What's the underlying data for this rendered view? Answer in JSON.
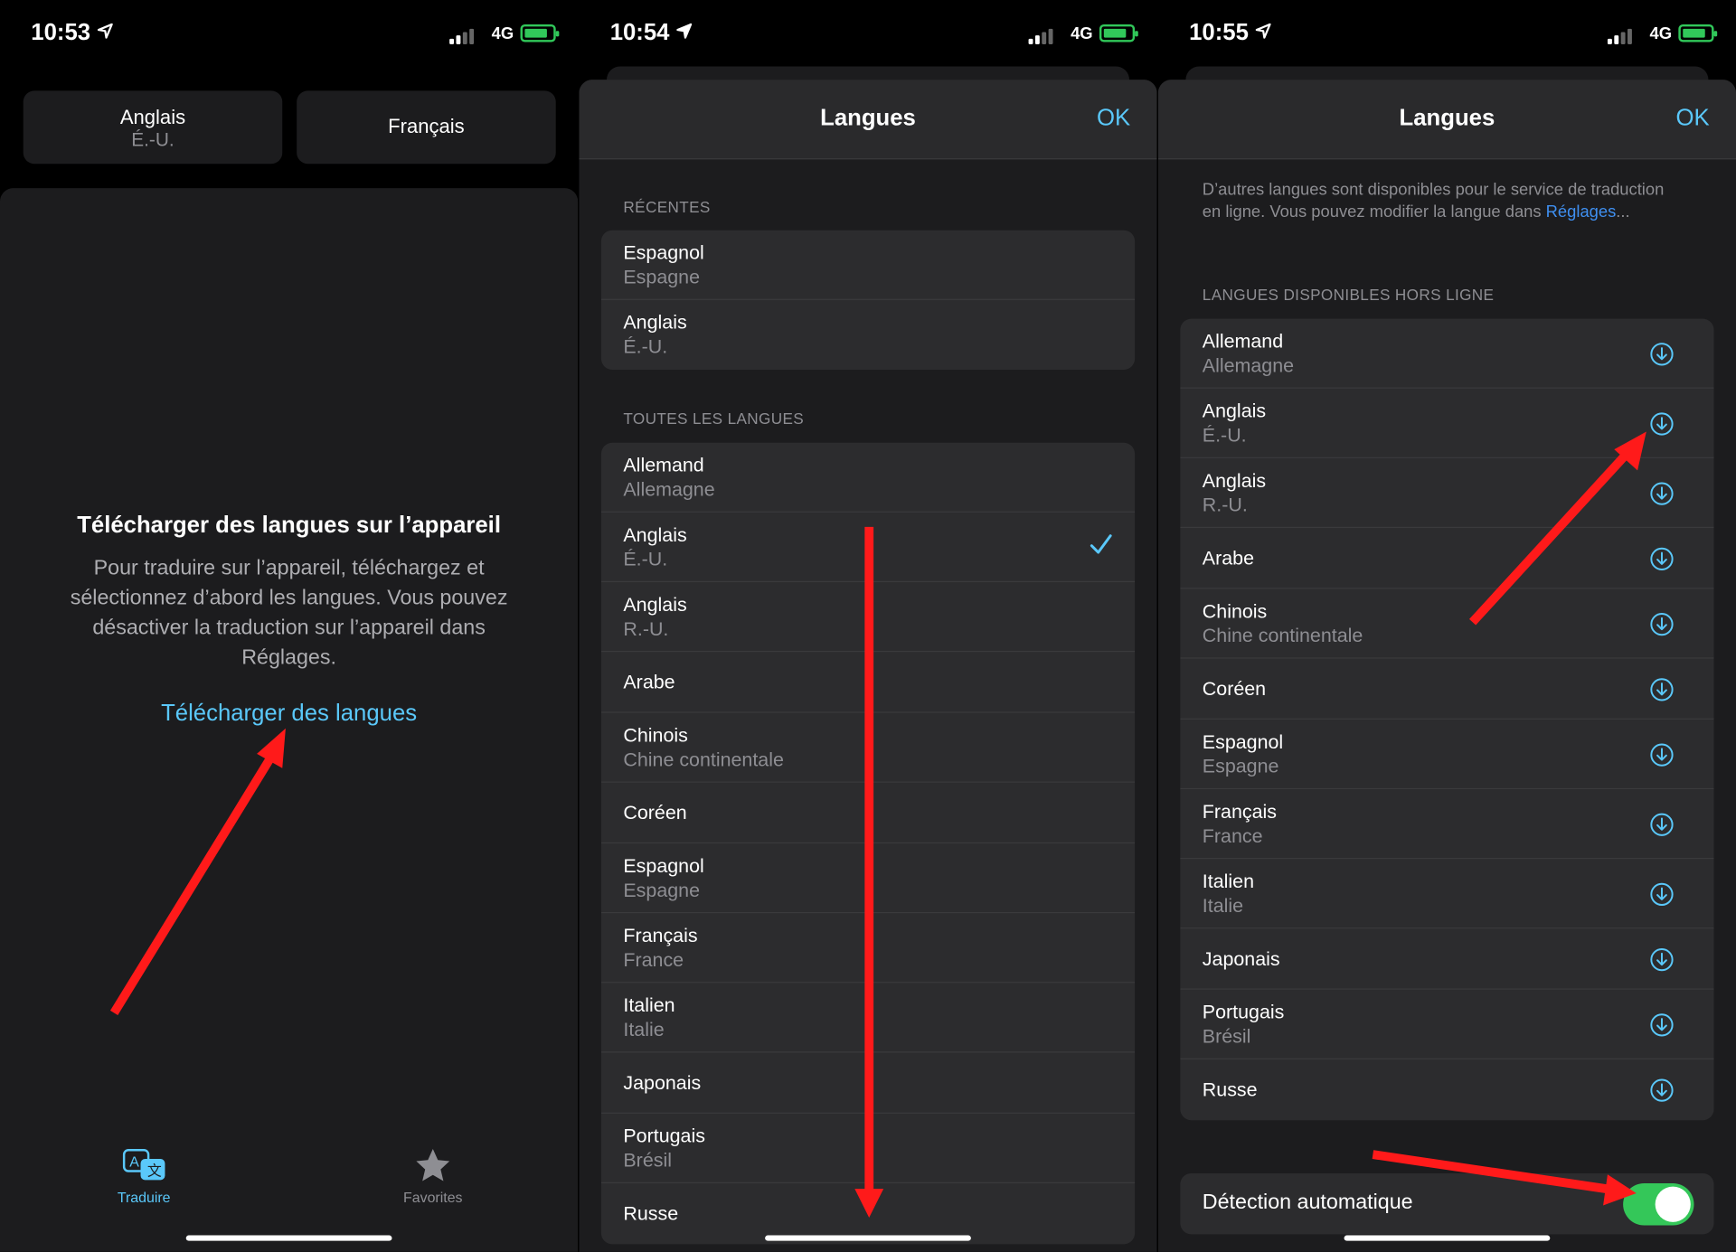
{
  "screens": [
    {
      "status": {
        "time": "10:53",
        "network": "4G"
      },
      "source_language": {
        "name": "Anglais",
        "region": "É.-U."
      },
      "target_language": {
        "name": "Français"
      },
      "download_title": "Télécharger des langues sur l’appareil",
      "download_body": "Pour traduire sur l’appareil, téléchargez et sélectionnez d’abord les langues. Vous pouvez désactiver la traduction sur l’appareil dans Réglages.",
      "download_link": "Télécharger des langues",
      "tabs": [
        {
          "label": "Traduire",
          "icon": "translate-icon",
          "active": true
        },
        {
          "label": "Favorites",
          "icon": "star-icon",
          "active": false
        }
      ]
    },
    {
      "status": {
        "time": "10:54",
        "network": "4G"
      },
      "nav": {
        "title": "Langues",
        "done": "OK"
      },
      "recent_header": "RÉCENTES",
      "recent": [
        {
          "name": "Espagnol",
          "region": "Espagne"
        },
        {
          "name": "Anglais",
          "region": "É.-U."
        }
      ],
      "all_header": "TOUTES LES LANGUES",
      "all": [
        {
          "name": "Allemand",
          "region": "Allemagne"
        },
        {
          "name": "Anglais",
          "region": "É.-U.",
          "checked": true
        },
        {
          "name": "Anglais",
          "region": "R.-U."
        },
        {
          "name": "Arabe",
          "region": ""
        },
        {
          "name": "Chinois",
          "region": "Chine continentale"
        },
        {
          "name": "Coréen",
          "region": ""
        },
        {
          "name": "Espagnol",
          "region": "Espagne"
        },
        {
          "name": "Français",
          "region": "France"
        },
        {
          "name": "Italien",
          "region": "Italie"
        },
        {
          "name": "Japonais",
          "region": ""
        },
        {
          "name": "Portugais",
          "region": "Brésil"
        },
        {
          "name": "Russe",
          "region": ""
        }
      ]
    },
    {
      "status": {
        "time": "10:55",
        "network": "4G"
      },
      "nav": {
        "title": "Langues",
        "done": "OK"
      },
      "info_text": "D’autres langues sont disponibles pour le service de traduction en ligne. Vous pouvez modifier la langue dans ",
      "info_link": "Réglages",
      "info_end": "...",
      "offline_header": "LANGUES DISPONIBLES HORS LIGNE",
      "offline": [
        {
          "name": "Allemand",
          "region": "Allemagne"
        },
        {
          "name": "Anglais",
          "region": "É.-U."
        },
        {
          "name": "Anglais",
          "region": "R.-U."
        },
        {
          "name": "Arabe",
          "region": ""
        },
        {
          "name": "Chinois",
          "region": "Chine continentale"
        },
        {
          "name": "Coréen",
          "region": ""
        },
        {
          "name": "Espagnol",
          "region": "Espagne"
        },
        {
          "name": "Français",
          "region": "France"
        },
        {
          "name": "Italien",
          "region": "Italie"
        },
        {
          "name": "Japonais",
          "region": ""
        },
        {
          "name": "Portugais",
          "region": "Brésil"
        },
        {
          "name": "Russe",
          "region": ""
        }
      ],
      "auto_detect": {
        "label": "Détection automatique",
        "on": true
      }
    }
  ],
  "colors": {
    "accent": "#5ac8fa",
    "toggle_on": "#34c759",
    "annotation_arrow": "#ff1a1a"
  }
}
